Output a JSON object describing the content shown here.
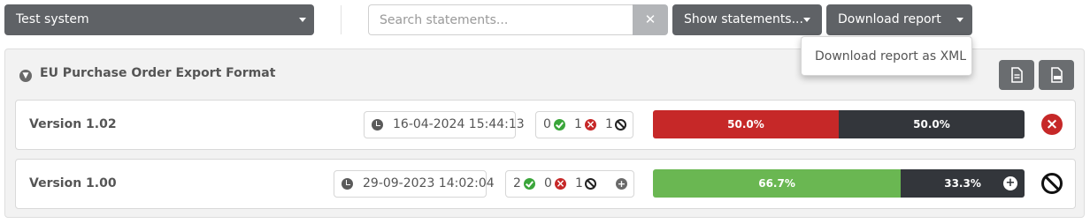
{
  "toolbar": {
    "system_select": "Test system",
    "search_placeholder": "Search statements...",
    "clear_label": "✕",
    "show_statements_label": "Show statements...",
    "download_report_label": "Download report",
    "download_menu": [
      "Download report as XML"
    ]
  },
  "panel": {
    "title": "EU Purchase Order Export Format",
    "actions": [
      "document-icon",
      "pdf-icon"
    ]
  },
  "versions": [
    {
      "name": "Version 1.02",
      "timestamp": "16-04-2024 15:44:13",
      "counts": {
        "passed": "0",
        "failed": "1",
        "skipped": "1"
      },
      "bar": [
        {
          "label": "50.0%",
          "fraction": 0.5,
          "color": "#c62828"
        },
        {
          "label": "50.0%",
          "fraction": 0.5,
          "color": "#33363b"
        }
      ],
      "status": "failed"
    },
    {
      "name": "Version 1.00",
      "timestamp": "29-09-2023 14:02:04",
      "counts": {
        "passed": "2",
        "failed": "0",
        "skipped": "1"
      },
      "bar": [
        {
          "label": "66.7%",
          "fraction": 0.667,
          "color": "#6ab752"
        },
        {
          "label": "33.3%",
          "fraction": 0.333,
          "color": "#33363b"
        }
      ],
      "status": "skipped"
    }
  ]
}
